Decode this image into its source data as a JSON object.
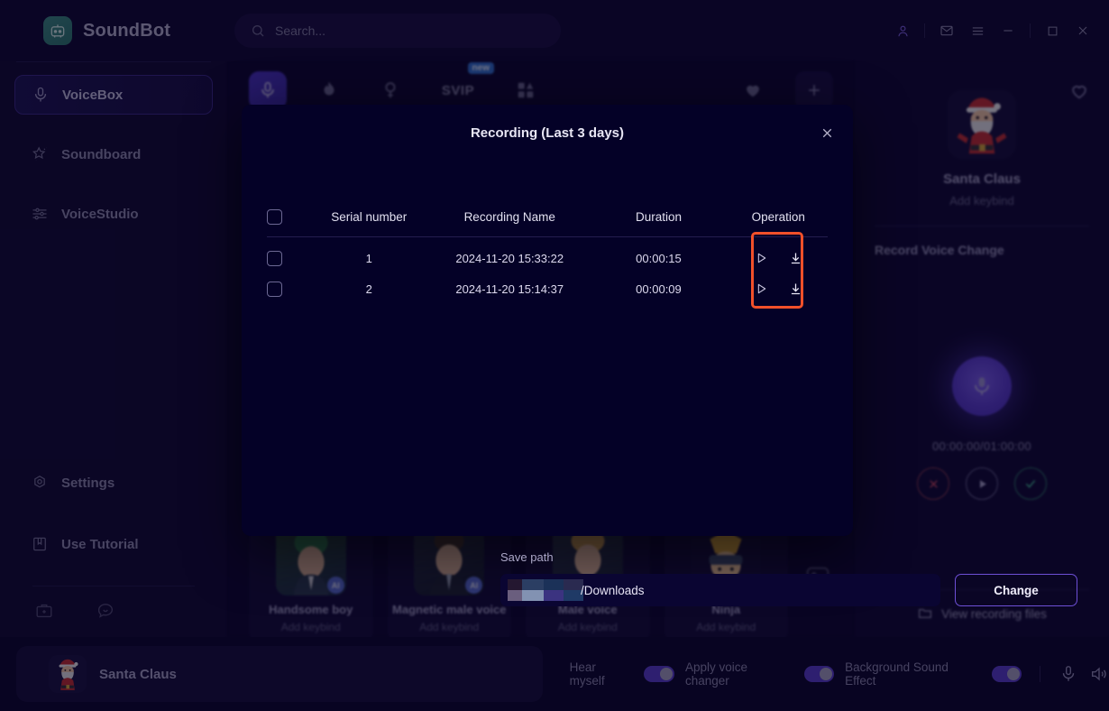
{
  "app": {
    "brand_name": "SoundBot",
    "brand_icon": "robot-icon"
  },
  "search": {
    "placeholder": "Search...",
    "icon": "search-icon"
  },
  "window_controls": [
    {
      "name": "account-icon",
      "glyph": "⚇"
    },
    {
      "name": "mail-icon",
      "glyph": "✉"
    },
    {
      "name": "menu-icon",
      "glyph": "≡"
    },
    {
      "name": "minimize-icon",
      "glyph": "—"
    },
    {
      "name": "maximize-icon",
      "glyph": "□"
    },
    {
      "name": "close-icon",
      "glyph": "✕"
    }
  ],
  "sidebar": {
    "items": [
      {
        "label": "VoiceBox",
        "icon": "microphone-icon",
        "active": true
      },
      {
        "label": "Soundboard",
        "icon": "magic-wand-icon",
        "active": false
      },
      {
        "label": "VoiceStudio",
        "icon": "sliders-icon",
        "active": false
      }
    ],
    "bottom_items": [
      {
        "label": "Settings",
        "icon": "gear-icon"
      },
      {
        "label": "Use Tutorial",
        "icon": "book-icon"
      }
    ],
    "mini_icons": [
      {
        "name": "briefcase-icon"
      },
      {
        "name": "chat-icon"
      }
    ]
  },
  "tabs": [
    {
      "name": "tab-voice",
      "icon": "microphone-icon",
      "selected": true
    },
    {
      "name": "tab-hot",
      "icon": "flame-icon",
      "selected": false
    },
    {
      "name": "tab-female",
      "icon": "venus-icon",
      "selected": false
    },
    {
      "name": "tab-svip",
      "icon": "svip-label",
      "label": "SVIP",
      "badge": "new",
      "selected": false
    },
    {
      "name": "tab-categories",
      "icon": "grid-icon",
      "selected": false
    },
    {
      "name": "tab-favorites",
      "icon": "heart-icon",
      "selected": false
    },
    {
      "name": "tab-add",
      "icon": "plus-icon",
      "selected": false
    }
  ],
  "voice_cards": [
    {
      "title": "Handsome boy",
      "subtitle": "Add keybind",
      "badge": "AI"
    },
    {
      "title": "Magnetic male voice",
      "subtitle": "Add keybind",
      "badge": "AI"
    },
    {
      "title": "Male voice",
      "subtitle": "Add keybind",
      "badge": "AI"
    },
    {
      "title": "Ninja",
      "subtitle": "Add keybind",
      "badge": ""
    }
  ],
  "right_panel": {
    "favorite_icon": "heart-outline-icon",
    "voice_name": "Santa Claus",
    "keybind_label": "Add keybind",
    "section_label": "Record Voice Change",
    "mic_icon": "microphone-icon",
    "timer": "00:00:00/01:00:00",
    "controls": [
      {
        "name": "cancel-recording-button",
        "icon": "x-icon"
      },
      {
        "name": "play-recording-button",
        "icon": "play-icon"
      },
      {
        "name": "confirm-recording-button",
        "icon": "check-icon"
      }
    ],
    "footer_label": "View recording files",
    "footer_icon": "folder-icon"
  },
  "bottom_bar": {
    "current_voice": "Santa Claus",
    "toggles": [
      {
        "label": "Hear myself",
        "on": true
      },
      {
        "label": "Apply voice changer",
        "on": true
      },
      {
        "label": "Background Sound Effect",
        "on": true
      }
    ],
    "icons": [
      {
        "name": "microphone-icon"
      },
      {
        "name": "speaker-icon"
      }
    ]
  },
  "modal": {
    "title": "Recording  (Last 3 days)",
    "close_icon": "close-icon",
    "columns": [
      "Serial number",
      "Recording Name",
      "Duration",
      "Operation"
    ],
    "rows": [
      {
        "serial": "1",
        "name": "2024-11-20 15:33:22",
        "duration": "00:00:15"
      },
      {
        "serial": "2",
        "name": "2024-11-20 15:14:37",
        "duration": "00:00:09"
      }
    ],
    "row_actions": [
      {
        "name": "play-button",
        "icon": "play-icon"
      },
      {
        "name": "download-button",
        "icon": "download-icon"
      }
    ],
    "save_path_label": "Save path",
    "save_path_value": "/Downloads",
    "save_path_redacted": true,
    "change_button_label": "Change",
    "highlight_color": "#f2502a"
  },
  "colors": {
    "accent": "#5a3fd4",
    "app_bg": "#0d0832",
    "sidebar_bg": "#110b38",
    "modal_bg": "#040127",
    "highlight": "#f2502a"
  }
}
